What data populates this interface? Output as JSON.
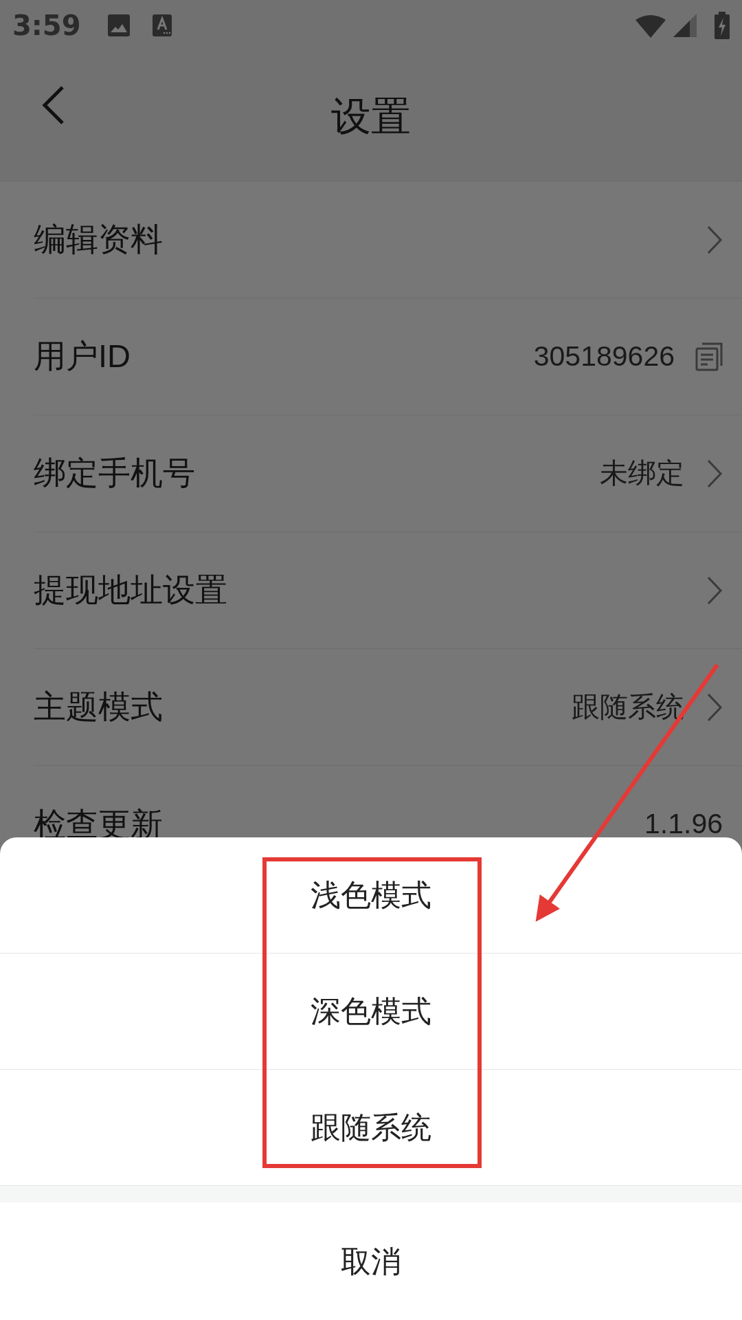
{
  "status_bar": {
    "time": "3:59"
  },
  "header": {
    "title": "设置"
  },
  "settings": [
    {
      "label": "编辑资料",
      "kind": "chevron"
    },
    {
      "label": "用户ID",
      "value": "305189626",
      "kind": "copy"
    },
    {
      "label": "绑定手机号",
      "value": "未绑定",
      "kind": "chevron"
    },
    {
      "label": "提现地址设置",
      "kind": "chevron"
    },
    {
      "label": "主题模式",
      "value": "跟随系统",
      "kind": "chevron"
    },
    {
      "label": "检查更新",
      "value": "1.1.96",
      "kind": "plain"
    }
  ],
  "sheet": {
    "options": [
      "浅色模式",
      "深色模式",
      "跟随系统"
    ],
    "cancel": "取消"
  }
}
